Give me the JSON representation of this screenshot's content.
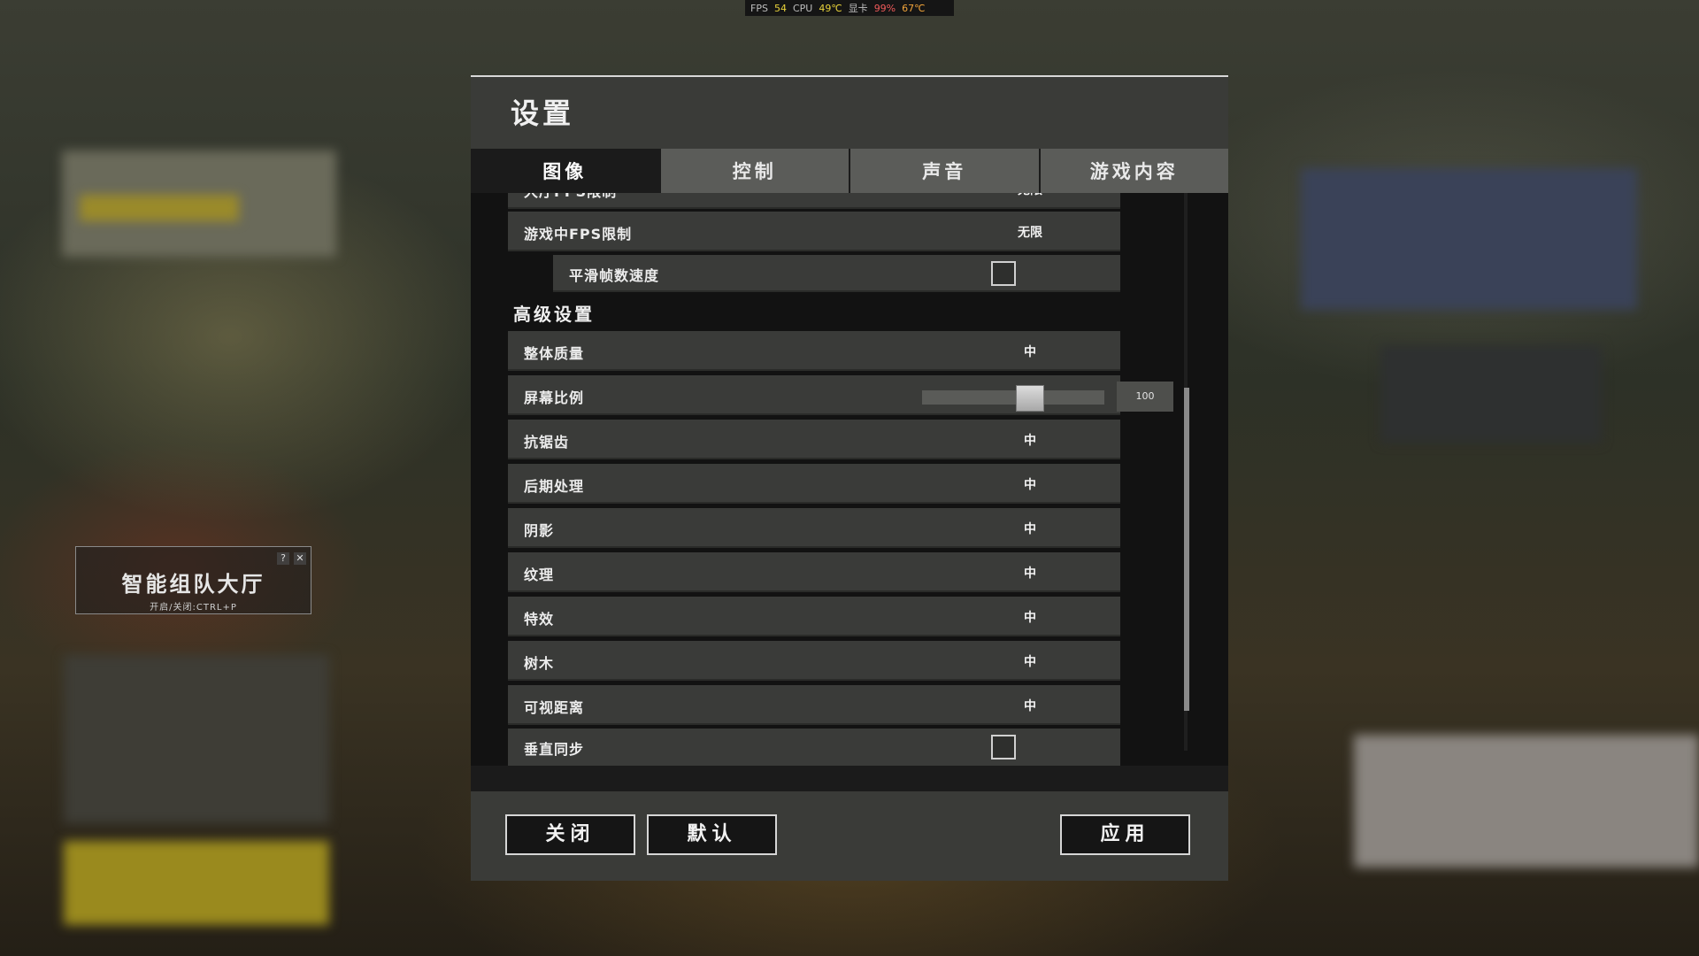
{
  "hud": {
    "fps_label": "FPS",
    "fps_value": "54",
    "cpu_label": "CPU",
    "cpu_temp": "49℃",
    "gpu_label": "显卡",
    "gpu_load": "99%",
    "gpu_temp": "67℃"
  },
  "lobby_widget": {
    "title": "智能组队大厅",
    "subtitle": "开启/关闭:CTRL+P",
    "help_icon": "?",
    "close_icon": "✕"
  },
  "dialog": {
    "title": "设置",
    "tabs": [
      {
        "label": "图像",
        "active": true
      },
      {
        "label": "控制",
        "active": false
      },
      {
        "label": "声音",
        "active": false
      },
      {
        "label": "游戏内容",
        "active": false
      }
    ],
    "partial_row": {
      "label": "大厅FPS限制",
      "value": "无限"
    },
    "fps_limit": {
      "label": "游戏中FPS限制",
      "value": "无限"
    },
    "smooth_framerate": {
      "label": "平滑帧数速度",
      "checked": false
    },
    "advanced_section": "高级设置",
    "advanced": [
      {
        "label": "整体质量",
        "value": "中"
      },
      {
        "label": "屏幕比例",
        "slider_value": "100",
        "slider_fraction": 0.6
      },
      {
        "label": "抗锯齿",
        "value": "中"
      },
      {
        "label": "后期处理",
        "value": "中"
      },
      {
        "label": "阴影",
        "value": "中"
      },
      {
        "label": "纹理",
        "value": "中"
      },
      {
        "label": "特效",
        "value": "中"
      },
      {
        "label": "树木",
        "value": "中"
      },
      {
        "label": "可视距离",
        "value": "中"
      }
    ],
    "vsync": {
      "label": "垂直同步",
      "checked": false
    },
    "buttons": {
      "close": "关闭",
      "default": "默认",
      "apply": "应用"
    }
  }
}
